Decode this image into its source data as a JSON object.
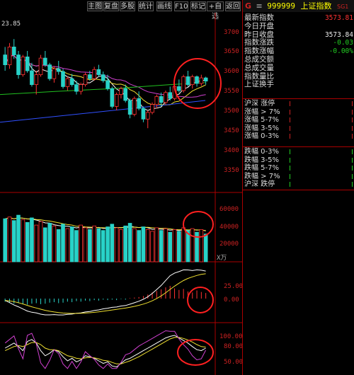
{
  "toolbar": {
    "buttons": [
      "主图",
      "复盘",
      "多股",
      "统计",
      "画线",
      "F10",
      "标记",
      "+自选",
      "返回"
    ]
  },
  "chart": {
    "price_marker": "23.85",
    "price_axis": [
      "3700",
      "3650",
      "3600",
      "3550",
      "3500",
      "3450",
      "3400",
      "3350"
    ],
    "volume_axis": [
      "60000",
      "40000",
      "20000"
    ],
    "volume_unit": "X万",
    "macd_axis": [
      "25.00",
      "0.00"
    ],
    "kdj_axis": [
      "100.00",
      "80.00",
      "50.00"
    ]
  },
  "colors": {
    "up": "#ff3232",
    "down": "#28d2c8",
    "ma5": "#ffffff",
    "ma10": "#f0e030",
    "ma20": "#d040d0",
    "ma60": "#20c020",
    "ma120": "#3050ff",
    "annotation": "#ff2020"
  },
  "chart_data": {
    "type": "candlestick",
    "candles": [
      [
        3640,
        3660,
        3600,
        3615
      ],
      [
        3615,
        3670,
        3605,
        3660
      ],
      [
        3660,
        3680,
        3630,
        3640
      ],
      [
        3640,
        3650,
        3580,
        3590
      ],
      [
        3590,
        3640,
        3585,
        3635
      ],
      [
        3635,
        3650,
        3595,
        3600
      ],
      [
        3600,
        3620,
        3560,
        3565
      ],
      [
        3565,
        3600,
        3540,
        3590
      ],
      [
        3590,
        3640,
        3585,
        3632
      ],
      [
        3632,
        3650,
        3610,
        3615
      ],
      [
        3615,
        3620,
        3575,
        3580
      ],
      [
        3580,
        3612,
        3570,
        3605
      ],
      [
        3605,
        3625,
        3590,
        3598
      ],
      [
        3598,
        3605,
        3555,
        3560
      ],
      [
        3560,
        3585,
        3550,
        3580
      ],
      [
        3580,
        3592,
        3560,
        3565
      ],
      [
        3565,
        3575,
        3540,
        3548
      ],
      [
        3548,
        3570,
        3540,
        3565
      ],
      [
        3565,
        3595,
        3560,
        3590
      ],
      [
        3590,
        3600,
        3575,
        3580
      ],
      [
        3580,
        3610,
        3575,
        3603
      ],
      [
        3603,
        3615,
        3585,
        3590
      ],
      [
        3590,
        3598,
        3570,
        3575
      ],
      [
        3575,
        3590,
        3550,
        3555
      ],
      [
        3555,
        3560,
        3505,
        3510
      ],
      [
        3510,
        3545,
        3500,
        3540
      ],
      [
        3540,
        3560,
        3530,
        3555
      ],
      [
        3555,
        3565,
        3520,
        3525
      ],
      [
        3525,
        3530,
        3480,
        3490
      ],
      [
        3490,
        3535,
        3485,
        3530
      ],
      [
        3530,
        3548,
        3500,
        3505
      ],
      [
        3505,
        3510,
        3470,
        3478
      ],
      [
        3478,
        3500,
        3455,
        3495
      ],
      [
        3495,
        3520,
        3490,
        3515
      ],
      [
        3515,
        3540,
        3505,
        3535
      ],
      [
        3535,
        3545,
        3510,
        3520
      ],
      [
        3520,
        3550,
        3515,
        3545
      ],
      [
        3545,
        3560,
        3525,
        3530
      ],
      [
        3530,
        3565,
        3525,
        3560
      ],
      [
        3560,
        3578,
        3545,
        3550
      ],
      [
        3550,
        3590,
        3545,
        3585
      ],
      [
        3585,
        3600,
        3560,
        3565
      ],
      [
        3565,
        3590,
        3555,
        3585
      ],
      [
        3585,
        3588,
        3560,
        3568
      ],
      [
        3568,
        3590,
        3562,
        3582
      ],
      [
        3582,
        3585,
        3565,
        3574
      ]
    ],
    "volume": [
      48000,
      50000,
      46000,
      52000,
      47000,
      44000,
      49000,
      41000,
      45000,
      38000,
      43000,
      40000,
      36000,
      42000,
      37000,
      39000,
      35000,
      41000,
      38000,
      36000,
      40000,
      37000,
      35000,
      39000,
      42000,
      38000,
      36000,
      40000,
      43000,
      37000,
      35000,
      39000,
      36000,
      34000,
      38000,
      35000,
      37000,
      33000,
      36000,
      34000,
      38000,
      35000,
      37000,
      33000,
      36000,
      31000
    ],
    "macd_hist": [
      -6,
      -8,
      -10,
      -9,
      -11,
      -12,
      -10,
      -9,
      -11,
      -10,
      -8,
      -7,
      -9,
      -8,
      -6,
      -7,
      -5,
      -6,
      -4,
      -5,
      -3,
      -4,
      -2,
      -3,
      -2,
      -3,
      -1,
      -2,
      1,
      2,
      3,
      5,
      8,
      12,
      15,
      18,
      22,
      25,
      20,
      17,
      19,
      14,
      12,
      16,
      13,
      11
    ],
    "kdj_k": [
      75,
      80,
      85,
      78,
      70,
      88,
      92,
      85,
      70,
      60,
      65,
      72,
      68,
      58,
      50,
      55,
      48,
      52,
      60,
      58,
      55,
      50,
      45,
      48,
      40,
      38,
      45,
      52,
      55,
      60,
      65,
      70,
      75,
      80,
      85,
      90,
      95,
      98,
      100,
      95,
      90,
      85,
      78,
      72,
      70,
      75
    ],
    "kdj_d": [
      70,
      74,
      78,
      80,
      78,
      82,
      86,
      86,
      82,
      75,
      72,
      72,
      70,
      65,
      60,
      58,
      55,
      54,
      56,
      57,
      56,
      54,
      51,
      50,
      47,
      44,
      44,
      47,
      50,
      54,
      58,
      63,
      68,
      73,
      78,
      83,
      88,
      93,
      96,
      96,
      94,
      91,
      87,
      82,
      78,
      77
    ]
  },
  "info": {
    "header": {
      "letter": "G",
      "menu": "≡",
      "code": "999999",
      "name": "上证指数",
      "tag": "SG1"
    },
    "rows": [
      {
        "label": "最新指数",
        "value": "3573.81",
        "cls": "v-red"
      },
      {
        "label": "今日开盘",
        "value": "",
        "cls": "v-white"
      },
      {
        "label": "昨日收盘",
        "value": "3573.84",
        "cls": "v-white"
      },
      {
        "label": "指数涨跌",
        "value": "-0.03",
        "cls": "v-green"
      },
      {
        "label": "指数涨幅",
        "value": "-0.00%",
        "cls": "v-green"
      },
      {
        "label": "总成交额",
        "value": "",
        "cls": "v-white"
      },
      {
        "label": "总成交量",
        "value": "",
        "cls": "v-white"
      },
      {
        "label": "指数量比",
        "value": "",
        "cls": "v-white"
      },
      {
        "label": "上证换手",
        "value": "",
        "cls": "v-white"
      }
    ],
    "up_stats": [
      "沪深 涨停",
      "涨幅 > 7%",
      "涨幅 5-7%",
      "涨幅 3-5%",
      "涨幅 0-3%"
    ],
    "down_stats": [
      "跌幅 0-3%",
      "跌幅 3-5%",
      "跌幅 5-7%",
      "跌幅 > 7%",
      "沪深 跌停"
    ]
  }
}
